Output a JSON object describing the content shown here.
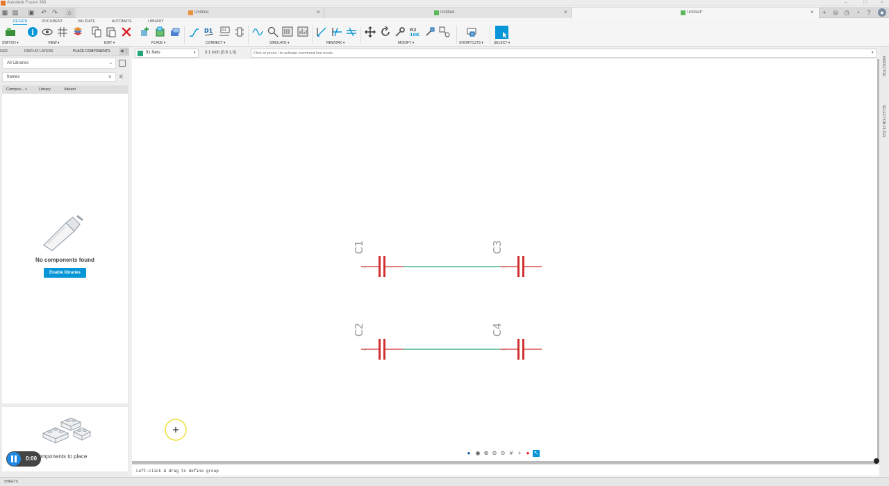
{
  "app": {
    "title": "Autodesk Fusion 360"
  },
  "doc_tabs": [
    {
      "label": "Untitled",
      "icon": "design-doc-icon"
    },
    {
      "label": "Untitled",
      "icon": "schematic-doc-icon"
    },
    {
      "label": "Untitled*",
      "icon": "schematic-doc-icon"
    }
  ],
  "ribbon": {
    "tabs": [
      "DESIGN",
      "DOCUMENT",
      "VALIDATE",
      "AUTOMATE",
      "LIBRARY"
    ],
    "groups": [
      "SWITCH",
      "VIEW",
      "EDIT",
      "PLACE",
      "CONNECT",
      "SIMULATE",
      "REWORK",
      "MODIFY",
      "SHORTCUTS",
      "SELECT"
    ],
    "connect_label": "D1",
    "connect_box": "01",
    "resistor_label": "R2",
    "resistor_value": "10K"
  },
  "left_panel": {
    "tabs": [
      "GER",
      "DISPLAY LAYERS",
      "PLACE COMPONENTS"
    ],
    "library_select": "All Libraries",
    "search_value": "frames",
    "columns": [
      "Compon...",
      "Library",
      "Variant"
    ],
    "empty_message": "No components found",
    "enable_button": "Enable libraries",
    "place_message": "ct components to place"
  },
  "recorder": {
    "time": "0:00"
  },
  "command_bar": {
    "net_select": "91 Nets",
    "grid_info": "0.1 inch (0.6 1.0)",
    "command_placeholder": "Click or press / to activate command line mode"
  },
  "schematic": {
    "components": [
      {
        "ref": "C1"
      },
      {
        "ref": "C3"
      },
      {
        "ref": "C2"
      },
      {
        "ref": "C4"
      }
    ],
    "colors": {
      "capacitor": "#d0302f",
      "net": "#27a37b",
      "label": "#999999",
      "cursor_ring": "#f0e040"
    }
  },
  "right_rail": {
    "tabs": [
      "INSPECTOR",
      "SELECTION FILTER"
    ]
  },
  "status": {
    "message": "Left-click & drag to define group",
    "sheets_label": "SHEETS"
  }
}
